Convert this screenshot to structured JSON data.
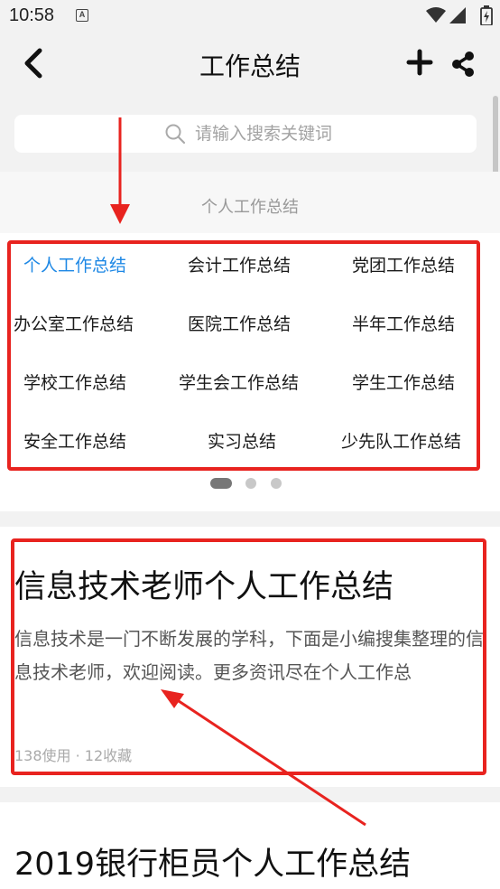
{
  "status_bar": {
    "time": "10:58",
    "notification_icon": "A"
  },
  "header": {
    "title": "工作总结",
    "back_icon": "chevron-left-icon",
    "add_icon": "plus-icon",
    "share_icon": "share-icon"
  },
  "search": {
    "placeholder": "请输入搜索关键词",
    "icon": "search-icon"
  },
  "section": {
    "title": "个人工作总结"
  },
  "categories": [
    {
      "label": "个人工作总结",
      "active": true
    },
    {
      "label": "会计工作总结",
      "active": false
    },
    {
      "label": "党团工作总结",
      "active": false
    },
    {
      "label": "办公室工作总结",
      "active": false
    },
    {
      "label": "医院工作总结",
      "active": false
    },
    {
      "label": "半年工作总结",
      "active": false
    },
    {
      "label": "学校工作总结",
      "active": false
    },
    {
      "label": "学生会工作总结",
      "active": false
    },
    {
      "label": "学生工作总结",
      "active": false
    },
    {
      "label": "安全工作总结",
      "active": false
    },
    {
      "label": "实习总结",
      "active": false
    },
    {
      "label": "少先队工作总结",
      "active": false
    }
  ],
  "pager": {
    "pages": 3,
    "current": 1
  },
  "articles": [
    {
      "title": "信息技术老师个人工作总结",
      "description": "信息技术是一门不断发展的学科，下面是小编搜集整理的信息技术老师，欢迎阅读。更多资讯尽在个人工作总",
      "meta": "138使用 · 12收藏"
    },
    {
      "title": "2019银行柜员个人工作总结"
    }
  ],
  "colors": {
    "accent": "#1e88e5",
    "annotation_red": "#e8231f",
    "background": "#f2f2f2"
  }
}
